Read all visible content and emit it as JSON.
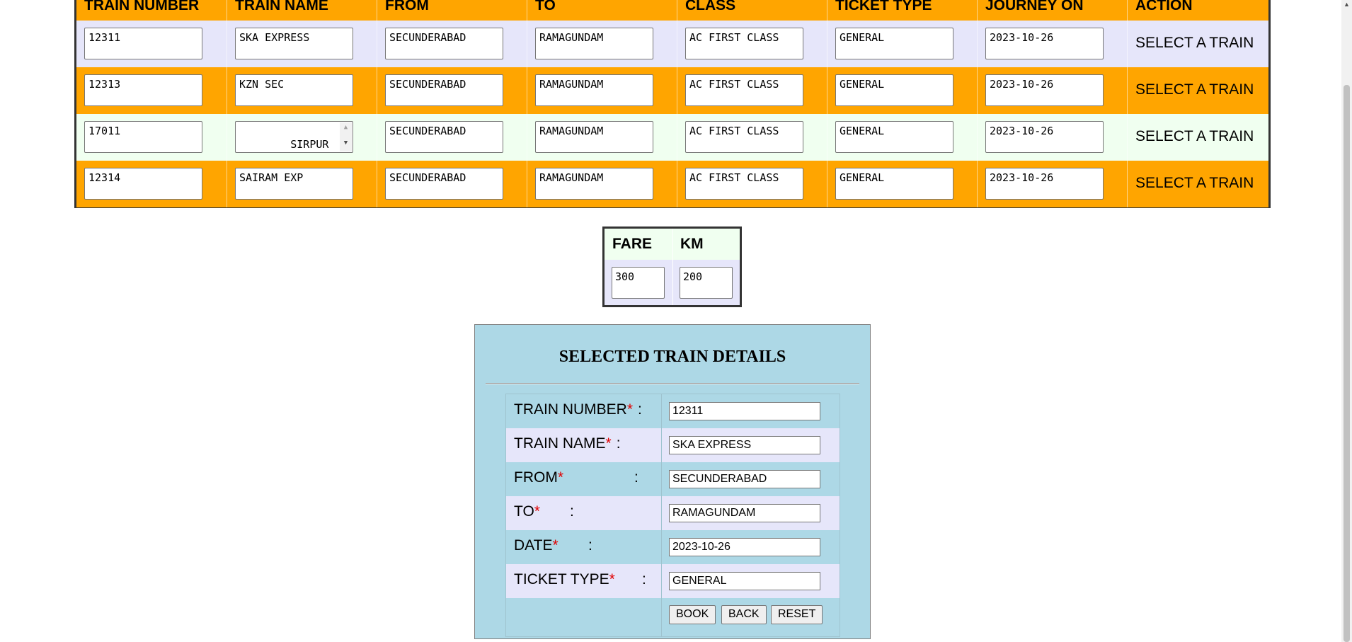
{
  "colors": {
    "row_orange": "#ffa500",
    "row_lavender": "#e6e6fa",
    "row_mint": "#f0fff0",
    "panel_bg": "#add8e6",
    "required": "#e00000"
  },
  "trains_table": {
    "headers": [
      "TRAIN NUMBER",
      "TRAIN NAME",
      "FROM",
      "TO",
      "CLASS",
      "TICKET TYPE",
      "JOURNEY ON",
      "ACTION"
    ],
    "rows": [
      {
        "bg": "#e6e6fa",
        "number": "12311",
        "name": "SKA EXPRESS",
        "from": "SECUNDERABAD",
        "to": "RAMAGUNDAM",
        "class": "AC FIRST CLASS",
        "ticket_type": "GENERAL",
        "journey_on": "2023-10-26",
        "action": "SELECT A TRAIN"
      },
      {
        "bg": "#ffa500",
        "number": "12313",
        "name": "KZN SEC",
        "from": "SECUNDERABAD",
        "to": "RAMAGUNDAM",
        "class": "AC FIRST CLASS",
        "ticket_type": "GENERAL",
        "journey_on": "2023-10-26",
        "action": "SELECT A TRAIN"
      },
      {
        "bg": "#f0fff0",
        "number": "17011",
        "name": "SIRPUR\nKAGHAZNAGAR",
        "from": "SECUNDERABAD",
        "to": "RAMAGUNDAM",
        "class": "AC FIRST CLASS",
        "ticket_type": "GENERAL",
        "journey_on": "2023-10-26",
        "action": "SELECT A TRAIN"
      },
      {
        "bg": "#ffa500",
        "number": "12314",
        "name": "SAIRAM EXP",
        "from": "SECUNDERABAD",
        "to": "RAMAGUNDAM",
        "class": "AC FIRST CLASS",
        "ticket_type": "GENERAL",
        "journey_on": "2023-10-26",
        "action": "SELECT A TRAIN"
      }
    ]
  },
  "fare_table": {
    "fare_label": "FARE",
    "km_label": "KM",
    "fare_value": "300",
    "km_value": "200"
  },
  "selected_panel": {
    "title": "SELECTED TRAIN DETAILS",
    "fields": [
      {
        "label": "TRAIN NUMBER",
        "value": "12311"
      },
      {
        "label": "TRAIN NAME",
        "value": "SKA EXPRESS"
      },
      {
        "label": "FROM",
        "value": "SECUNDERABAD"
      },
      {
        "label": "TO",
        "value": "RAMAGUNDAM"
      },
      {
        "label": "DATE",
        "value": "2023-10-26"
      },
      {
        "label": "TICKET TYPE",
        "value": "GENERAL"
      }
    ],
    "required_mark": "*",
    "colon": ":",
    "buttons": {
      "book": "BOOK",
      "back": "BACK",
      "reset": "RESET"
    }
  },
  "icons": {
    "scroll_up": "triangle-up",
    "scroll_down": "triangle-down"
  }
}
